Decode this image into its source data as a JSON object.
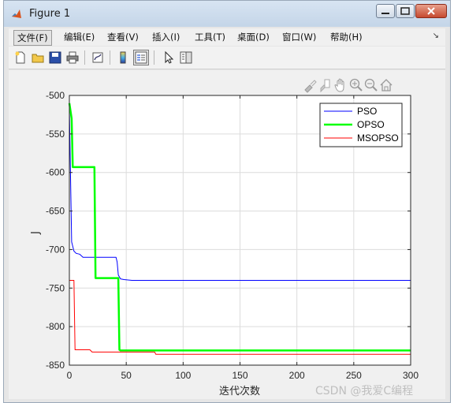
{
  "window": {
    "title": "Figure 1"
  },
  "menubar": {
    "items": [
      "文件(F)",
      "编辑(E)",
      "查看(V)",
      "插入(I)",
      "工具(T)",
      "桌面(D)",
      "窗口(W)",
      "帮助(H)"
    ],
    "overflow_arrow": "↘"
  },
  "toolbar": {
    "icons": [
      "new-figure-icon",
      "open-file-icon",
      "save-icon",
      "print-icon",
      "link-plot-icon",
      "colorbar-icon",
      "legend-icon",
      "pointer-icon",
      "property-inspector-icon"
    ]
  },
  "axes_toolbar": {
    "icons": [
      "brush-icon",
      "data-tips-icon",
      "pan-hand-icon",
      "zoom-in-icon",
      "zoom-out-icon",
      "home-icon"
    ]
  },
  "chart_data": {
    "type": "line",
    "title": "",
    "xlabel": "迭代次数",
    "ylabel": "J",
    "xlim": [
      0,
      300
    ],
    "ylim": [
      -850,
      -500
    ],
    "xticks": [
      0,
      50,
      100,
      150,
      200,
      250,
      300
    ],
    "yticks": [
      -850,
      -800,
      -750,
      -700,
      -650,
      -600,
      -550,
      -500
    ],
    "grid": true,
    "legend_position": "top-right",
    "series": [
      {
        "name": "PSO",
        "color": "#0000ff",
        "width": 1,
        "points": [
          [
            0,
            -515
          ],
          [
            1,
            -600
          ],
          [
            2,
            -690
          ],
          [
            4,
            -702
          ],
          [
            6,
            -705
          ],
          [
            9,
            -706
          ],
          [
            12,
            -710
          ],
          [
            20,
            -710
          ],
          [
            30,
            -710
          ],
          [
            41,
            -710
          ],
          [
            42,
            -716
          ],
          [
            43,
            -733
          ],
          [
            45,
            -738
          ],
          [
            48,
            -739
          ],
          [
            55,
            -740
          ],
          [
            300,
            -740
          ]
        ]
      },
      {
        "name": "OPSO",
        "color": "#00ff00",
        "width": 2.5,
        "points": [
          [
            0,
            -510
          ],
          [
            2,
            -530
          ],
          [
            3,
            -593
          ],
          [
            22,
            -593
          ],
          [
            23,
            -737
          ],
          [
            43,
            -737
          ],
          [
            44,
            -830
          ],
          [
            45,
            -831
          ],
          [
            300,
            -831
          ]
        ]
      },
      {
        "name": "MSOPSO",
        "color": "#ff0000",
        "width": 1,
        "points": [
          [
            0,
            -740
          ],
          [
            4,
            -740
          ],
          [
            5,
            -830
          ],
          [
            18,
            -830
          ],
          [
            20,
            -833
          ],
          [
            75,
            -833
          ],
          [
            76,
            -836
          ],
          [
            300,
            -836
          ]
        ]
      }
    ]
  },
  "watermark": "CSDN @我爱C编程"
}
